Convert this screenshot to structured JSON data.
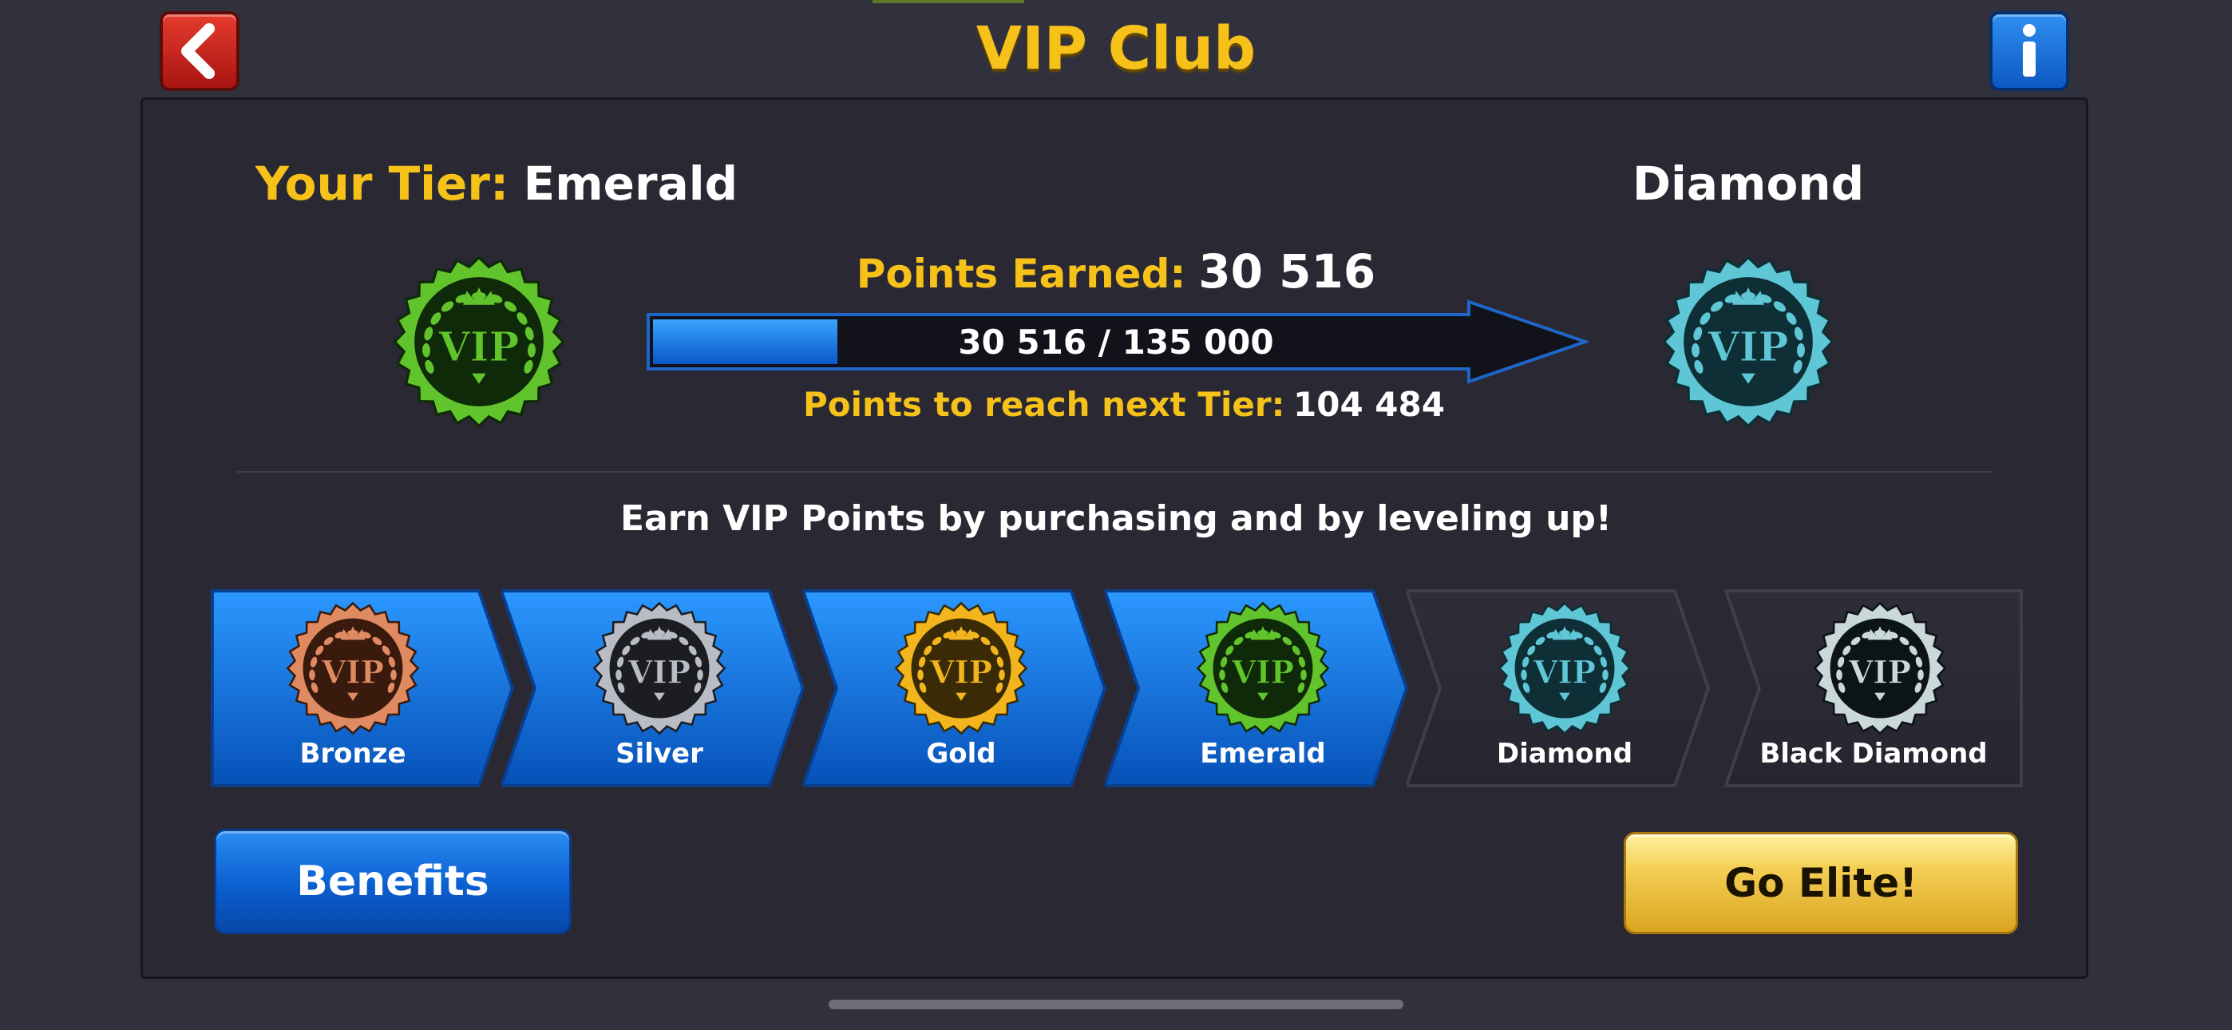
{
  "header": {
    "title": "VIP Club",
    "back_icon": "chevron-left-icon",
    "info_icon": "info-icon"
  },
  "current": {
    "label": "Your Tier:",
    "tier": "Emerald",
    "badge_text": "VIP"
  },
  "next": {
    "tier": "Diamond",
    "badge_text": "VIP"
  },
  "progress": {
    "earned_label": "Points Earned:",
    "earned_value": "30 516",
    "bar_text": "30 516 / 135 000",
    "fraction": 0.226,
    "to_next_label": "Points to reach next Tier:",
    "to_next_value": "104 484"
  },
  "earn_text": "Earn VIP Points by purchasing and by leveling up!",
  "tiers": [
    {
      "name": "Bronze",
      "badge_text": "VIP",
      "color": "#e08a62",
      "achieved": true
    },
    {
      "name": "Silver",
      "badge_text": "VIP",
      "color": "#b9bcc4",
      "achieved": true
    },
    {
      "name": "Gold",
      "badge_text": "VIP",
      "color": "#f2b51e",
      "achieved": true
    },
    {
      "name": "Emerald",
      "badge_text": "VIP",
      "color": "#62c42c",
      "achieved": true
    },
    {
      "name": "Diamond",
      "badge_text": "VIP",
      "color": "#5fc6d6",
      "achieved": false
    },
    {
      "name": "Black Diamond",
      "badge_text": "VIP",
      "color": "#c9d8da",
      "achieved": false
    }
  ],
  "buttons": {
    "benefits": "Benefits",
    "go_elite": "Go Elite!"
  },
  "colors": {
    "accent_yellow": "#f6c21a",
    "tier_blue": "#0b6fe0",
    "panel": "#292833"
  }
}
